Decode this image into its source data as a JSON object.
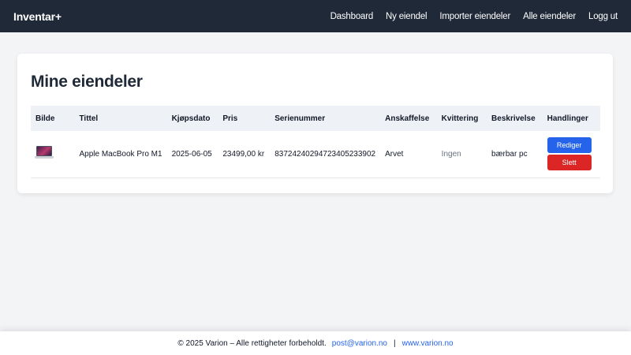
{
  "header": {
    "brand": "Inventar+",
    "nav": [
      "Dashboard",
      "Ny eiendel",
      "Importer eiendeler",
      "Alle eiendeler",
      "Logg ut"
    ]
  },
  "main": {
    "title": "Mine eiendeler",
    "columns": [
      "Bilde",
      "Tittel",
      "Kjøpsdato",
      "Pris",
      "Serienummer",
      "Anskaffelse",
      "Kvittering",
      "Beskrivelse",
      "Handlinger"
    ],
    "rows": [
      {
        "image": "laptop-icon",
        "title": "Apple MacBook Pro M1",
        "purchase_date": "2025-06-05",
        "price": "23499,00 kr",
        "serial": "83724240294723405233902",
        "acquisition": "Arvet",
        "receipt": "Ingen",
        "description": "bærbar pc",
        "edit_label": "Rediger",
        "delete_label": "Slett"
      }
    ]
  },
  "footer": {
    "copyright": "© 2025 Varion – Alle rettigheter forbeholdt.",
    "email": "post@varion.no",
    "separator": "|",
    "website": "www.varion.no"
  },
  "colors": {
    "header_bg": "#1f2937",
    "edit_button": "#2563eb",
    "delete_button": "#dc2626",
    "link": "#2563eb"
  }
}
